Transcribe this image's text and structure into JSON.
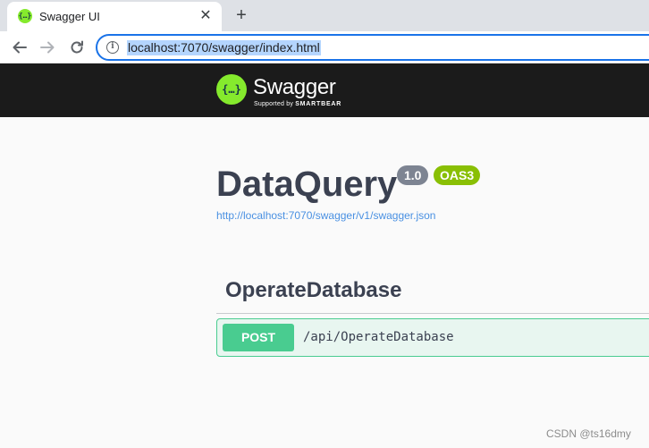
{
  "browser": {
    "tab_title": "Swagger UI",
    "tab_close": "✕",
    "new_tab": "+",
    "url": "localhost:7070/swagger/index.html",
    "info_icon": "i"
  },
  "topbar": {
    "logo_symbol": "{…}",
    "logo_text": "Swagger",
    "logo_sub_prefix": "Supported by",
    "logo_sub_brand": "SMARTBEAR"
  },
  "info": {
    "title": "DataQuery",
    "version": "1.0",
    "oas": "OAS3",
    "spec_url": "http://localhost:7070/swagger/v1/swagger.json"
  },
  "operations": {
    "tag": "OperateDatabase",
    "items": [
      {
        "method": "POST",
        "path": "/api/OperateDatabase"
      }
    ]
  },
  "watermark": "CSDN @ts16dmy",
  "colors": {
    "swagger_green": "#85ea2d",
    "post_green": "#49cc90",
    "oas_badge": "#89bf04",
    "version_badge": "#7d8492",
    "topbar_bg": "#1b1b1b"
  }
}
